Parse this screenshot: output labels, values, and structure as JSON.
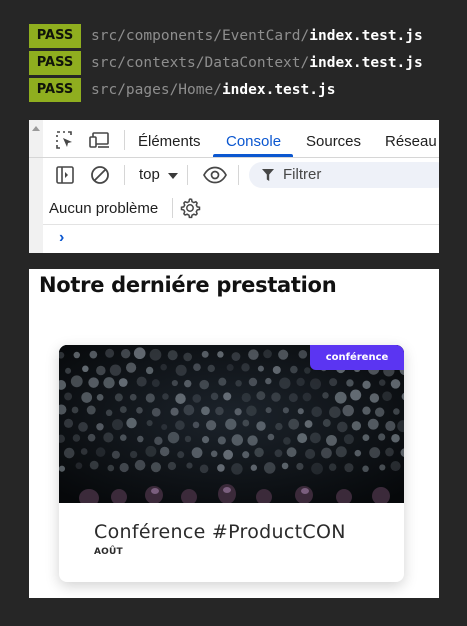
{
  "terminal": {
    "tests": [
      {
        "status": "PASS",
        "path": "src/components/EventCard/",
        "file": "index.test.js"
      },
      {
        "status": "PASS",
        "path": "src/contexts/DataContext/",
        "file": "index.test.js"
      },
      {
        "status": "PASS",
        "path": "src/pages/Home/",
        "file": "index.test.js"
      }
    ],
    "pass_color": "#8fae1f"
  },
  "devtools": {
    "tabs": [
      "Éléments",
      "Console",
      "Sources",
      "Réseau"
    ],
    "active_tab": "Console",
    "context": "top",
    "filter_placeholder": "Filtrer",
    "issues": "Aucun problème",
    "prompt": "›",
    "accent": "#0b57d0",
    "icons": [
      "inspect-icon",
      "device-icon",
      "sidebar-icon",
      "clear-icon",
      "eye-icon",
      "filter-icon",
      "gear-icon"
    ]
  },
  "page": {
    "title": "Notre derniére prestation",
    "card": {
      "tag": "conférence",
      "title": "Conférence #ProductCON",
      "month": "AOÛT",
      "tag_color": "#5b35f2"
    }
  }
}
